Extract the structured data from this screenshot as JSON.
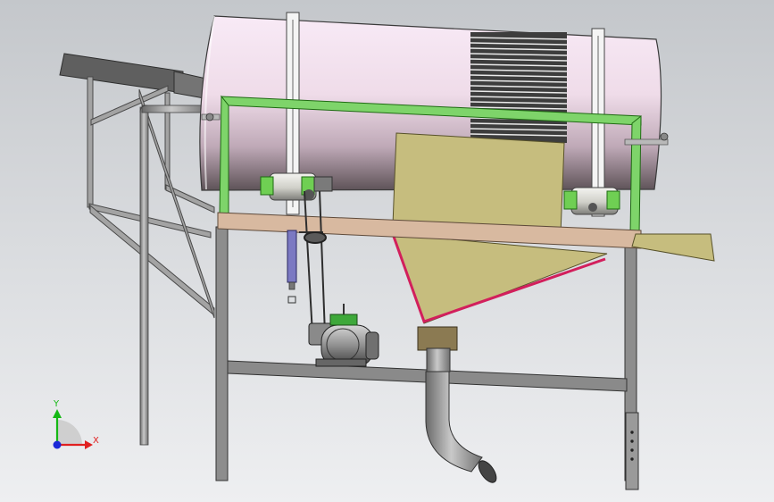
{
  "triad": {
    "x_label": "X",
    "y_label": "Y",
    "x_color": "#e02020",
    "y_color": "#14b814",
    "z_color": "#1a28d8"
  },
  "colors": {
    "drum_light": "#f7e9f4",
    "drum_mid": "#d8c2d0",
    "drum_dark": "#6f6268",
    "outer_frame": "#7ed46a",
    "deck": "#d8b9a0",
    "hopper": "#c6bd7e",
    "hopper_edge": "#d21f5c",
    "metal": "#9a9a9a",
    "chute": "#6e6e6e"
  },
  "icons": {
    "bearings": [
      "bearing-icon",
      "bearing-icon"
    ],
    "motor": "motor-icon"
  }
}
